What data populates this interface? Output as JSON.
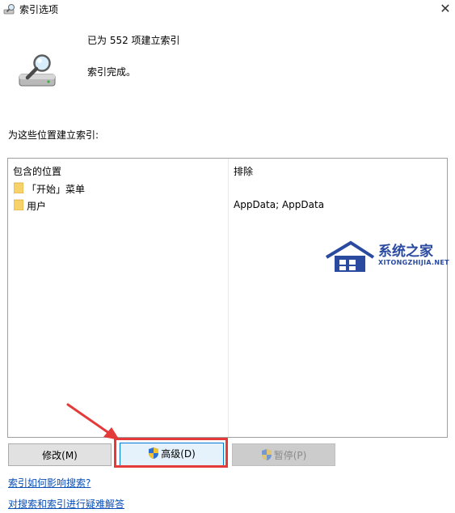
{
  "window": {
    "title": "索引选项",
    "close_glyph": "✕",
    "app_icon": "indexing-options-icon"
  },
  "status": {
    "icon": "drive-magnifier-icon",
    "count_text": "已为 552 项建立索引",
    "done_text": "索引完成。"
  },
  "locations": {
    "section_label": "为这些位置建立索引:",
    "headers": {
      "included": "包含的位置",
      "excluded": "排除"
    },
    "rows": [
      {
        "icon": "folder-icon",
        "location": "「开始」菜单",
        "exclude": ""
      },
      {
        "icon": "folder-icon",
        "location": "用户",
        "exclude": "AppData; AppData"
      }
    ]
  },
  "buttons": {
    "modify": "修改(M)",
    "advanced": "高级(D)",
    "pause": "暂停(P)",
    "shield_icon": "uac-shield-icon"
  },
  "links": {
    "how_affects": "索引如何影响搜索?",
    "troubleshoot": "对搜索和索引进行疑难解答"
  },
  "watermark": {
    "name": "系统之家",
    "url": "XITONGZHIJIA.NET"
  },
  "colors": {
    "link": "#0a4fb8",
    "highlight": "#e43a3a",
    "focus": "#0078d7",
    "watermark": "#2a4aa0"
  }
}
